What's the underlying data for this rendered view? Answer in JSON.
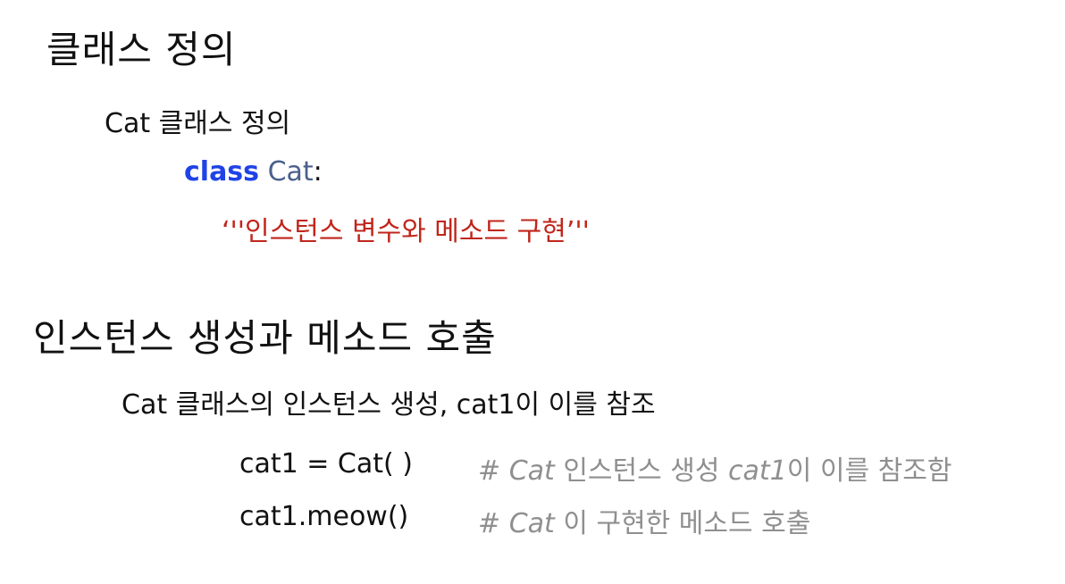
{
  "section1": {
    "title": "클래스 정의",
    "subtitle": "Cat 클래스 정의",
    "code": {
      "keyword": "class",
      "class_name": "Cat",
      "colon": ":",
      "docstring": "‘''인스턴스 변수와 메소드 구현’''"
    }
  },
  "section2": {
    "title": "인스턴스 생성과 메소드 호출",
    "subtitle": "Cat 클래스의 인스턴스 생성, cat1이 이를 참조",
    "lines": [
      {
        "code": "cat1 = Cat( )",
        "comment_hash": "#",
        "comment_italic": "Cat",
        "comment_mid": "인스턴스 생성",
        "comment_italic2": "cat1",
        "comment_end": "이 이를 참조함"
      },
      {
        "code": "cat1.meow()",
        "comment_hash": "#",
        "comment_italic": "Cat",
        "comment_end": "이 구현한 메소드 호출"
      }
    ]
  },
  "colors": {
    "keyword": "#1f43e6",
    "class_name": "#4a5f8c",
    "string": "#c0261c",
    "comment": "#8f8f8f"
  }
}
